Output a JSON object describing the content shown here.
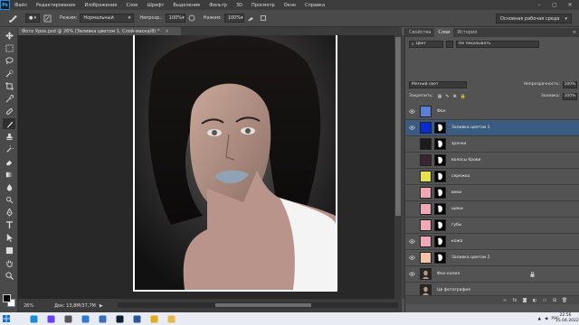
{
  "menubar": {
    "logo": "Ps",
    "items": [
      "Файл",
      "Редактирование",
      "Изображение",
      "Слои",
      "Шрифт",
      "Выделение",
      "Фильтр",
      "3D",
      "Просмотр",
      "Окно",
      "Справка"
    ]
  },
  "options": {
    "mode_label": "Режим:",
    "mode_value": "Нормальный",
    "opacity_label": "Непрозр.:",
    "opacity_value": "100%",
    "flow_label": "Нажим:",
    "flow_value": "100%",
    "workspace": "Основная рабочая среда"
  },
  "document": {
    "tab_title": "Фото Урок.psd @ 26% (Заливка цветом 1, Слой-маска/8) *",
    "zoom": "26%",
    "doc_info": "Док: 13,8М/37,7М"
  },
  "panel": {
    "tabs": [
      "Свойства",
      "Слои",
      "История"
    ],
    "active_tab": "Слои",
    "filter_kind": "Цвет",
    "filter_value": "Не показывать",
    "blend_mode": "Мягкий свет",
    "opacity_label": "Непрозрачность:",
    "opacity_value": "100%",
    "lock_label": "Закрепить:",
    "fill_label": "Заливка:",
    "fill_value": "100%",
    "layers": [
      {
        "name": "Фон",
        "color": "#5b7fd8",
        "visible": true,
        "selected": false,
        "kind": "color"
      },
      {
        "name": "Заливка цветом 1",
        "color": "#0a2bd0",
        "visible": true,
        "selected": true,
        "kind": "color-mask"
      },
      {
        "name": "зрачки",
        "color": "#1c1c1c",
        "visible": false,
        "selected": false,
        "kind": "color-mask"
      },
      {
        "name": "волосы брови",
        "color": "#3a2530",
        "visible": false,
        "selected": false,
        "kind": "color-mask"
      },
      {
        "name": "сережка",
        "color": "#e6e04a",
        "visible": false,
        "selected": false,
        "kind": "color-mask"
      },
      {
        "name": "веки",
        "color": "#f0a7b6",
        "visible": false,
        "selected": false,
        "kind": "color-mask"
      },
      {
        "name": "щеки",
        "color": "#f0a7b6",
        "visible": false,
        "selected": false,
        "kind": "color-mask"
      },
      {
        "name": "губы",
        "color": "#f0a7b6",
        "visible": false,
        "selected": false,
        "kind": "color-mask"
      },
      {
        "name": "кожа",
        "color": "#f0a7b6",
        "visible": true,
        "selected": false,
        "kind": "color-mask"
      },
      {
        "name": "Заливка цветом 2",
        "color": "#f3c4a8",
        "visible": true,
        "selected": false,
        "kind": "color-mask"
      },
      {
        "name": "Фон копия",
        "color": "#6a6a6a",
        "visible": true,
        "selected": false,
        "kind": "photo"
      },
      {
        "name": "Цв фотография",
        "color": "#6a6a6a",
        "visible": false,
        "selected": false,
        "kind": "photo"
      }
    ]
  },
  "taskbar": {
    "icons": [
      "edge-icon",
      "yandex-icon",
      "taskview-icon",
      "store-icon",
      "vk-icon",
      "photoshop-icon",
      "word-icon",
      "chrome-icon",
      "folder-icon"
    ],
    "lang": "РУС",
    "time": "22:56",
    "date": "15.04.2022"
  },
  "colors": {
    "accent": "#3b5b81",
    "panel": "#535353",
    "dark": "#3c3c3c"
  }
}
